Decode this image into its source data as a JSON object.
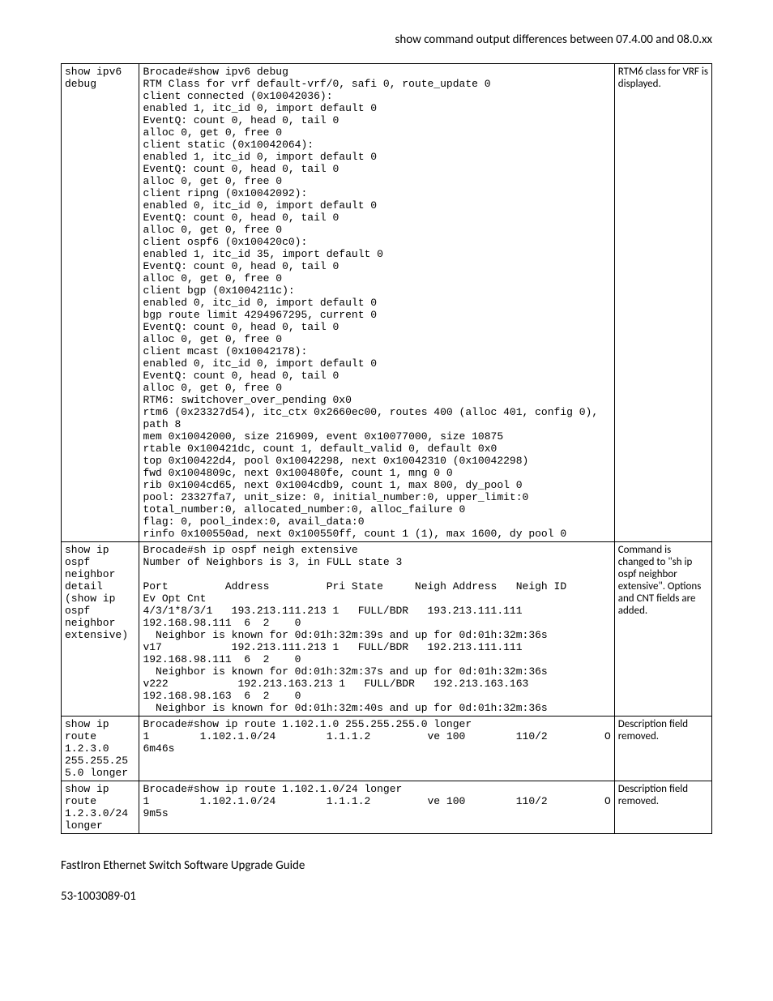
{
  "header": "show command output differences between 07.4.00 and 08.0.xx",
  "rows": [
    {
      "cmd": "show ipv6 debug",
      "out": "Brocade#show ipv6 debug\nRTM Class for vrf default-vrf/0, safi 0, route_update 0\nclient connected (0x10042036):\nenabled 1, itc_id 0, import default 0\nEventQ: count 0, head 0, tail 0\nalloc 0, get 0, free 0\nclient static (0x10042064):\nenabled 1, itc_id 0, import default 0\nEventQ: count 0, head 0, tail 0\nalloc 0, get 0, free 0\nclient ripng (0x10042092):\nenabled 0, itc_id 0, import default 0\nEventQ: count 0, head 0, tail 0\nalloc 0, get 0, free 0\nclient ospf6 (0x100420c0):\nenabled 1, itc_id 35, import default 0\nEventQ: count 0, head 0, tail 0\nalloc 0, get 0, free 0\nclient bgp (0x1004211c):\nenabled 0, itc_id 0, import default 0\nbgp route limit 4294967295, current 0\nEventQ: count 0, head 0, tail 0\nalloc 0, get 0, free 0\nclient mcast (0x10042178):\nenabled 0, itc_id 0, import default 0\nEventQ: count 0, head 0, tail 0\nalloc 0, get 0, free 0\nRTM6: switchover_over_pending 0x0\nrtm6 (0x23327d54), itc_ctx 0x2660ec00, routes 400 (alloc 401, config 0),\npath 8\nmem 0x10042000, size 216909, event 0x10077000, size 10875\nrtable 0x100421dc, count 1, default_valid 0, default 0x0\ntop 0x100422d4, pool 0x10042298, next 0x10042310 (0x10042298)\nfwd 0x1004809c, next 0x100480fe, count 1, mng 0 0\nrib 0x1004cd65, next 0x1004cdb9, count 1, max 800, dy_pool 0\npool: 23327fa7, unit_size: 0, initial_number:0, upper_limit:0\ntotal_number:0, allocated_number:0, alloc_failure 0\nflag: 0, pool_index:0, avail_data:0\nrinfo 0x100550ad, next 0x100550ff, count 1 (1), max 1600, dy pool 0",
      "note": "RTM6 class for VRF is displayed."
    },
    {
      "cmd": "show ip ospf neighbor detail\n(show ip ospf neighbor extensive)",
      "out": "Brocade#sh ip ospf neigh extensive\nNumber of Neighbors is 3, in FULL state 3\n\nPort         Address         Pri State     Neigh Address   Neigh ID\nEv Opt Cnt\n4/3/1*8/3/1   193.213.111.213 1   FULL/BDR   193.213.111.111\n192.168.98.111  6  2    0\n  Neighbor is known for 0d:01h:32m:39s and up for 0d:01h:32m:36s\nv17           192.213.111.213 1   FULL/BDR   192.213.111.111\n192.168.98.111  6  2    0\n  Neighbor is known for 0d:01h:32m:37s and up for 0d:01h:32m:36s\nv222           192.213.163.213 1   FULL/BDR   192.213.163.163\n192.168.98.163  6  2    0\n  Neighbor is known for 0d:01h:32m:40s and up for 0d:01h:32m:36s\n",
      "note": "Command is changed to \"sh ip ospf neighbor extensive\". Options and CNT fields are added."
    },
    {
      "cmd": "show ip route 1.2.3.0 255.255.25\n5.0 longer\n",
      "out": "Brocade#show ip route 1.102.1.0 255.255.255.0 longer\n1        1.102.1.0/24        1.1.1.2         ve 100        110/2         O\n6m46s",
      "note": "Description field removed."
    },
    {
      "cmd": "show ip route 1.2.3.0/24 longer",
      "out": "Brocade#show ip route 1.102.1.0/24 longer\n1        1.102.1.0/24        1.1.1.2         ve 100        110/2         O\n9m5s",
      "note": "Description field removed."
    }
  ],
  "footer1": "FastIron Ethernet Switch Software Upgrade Guide",
  "footer2": "53-1003089-01"
}
